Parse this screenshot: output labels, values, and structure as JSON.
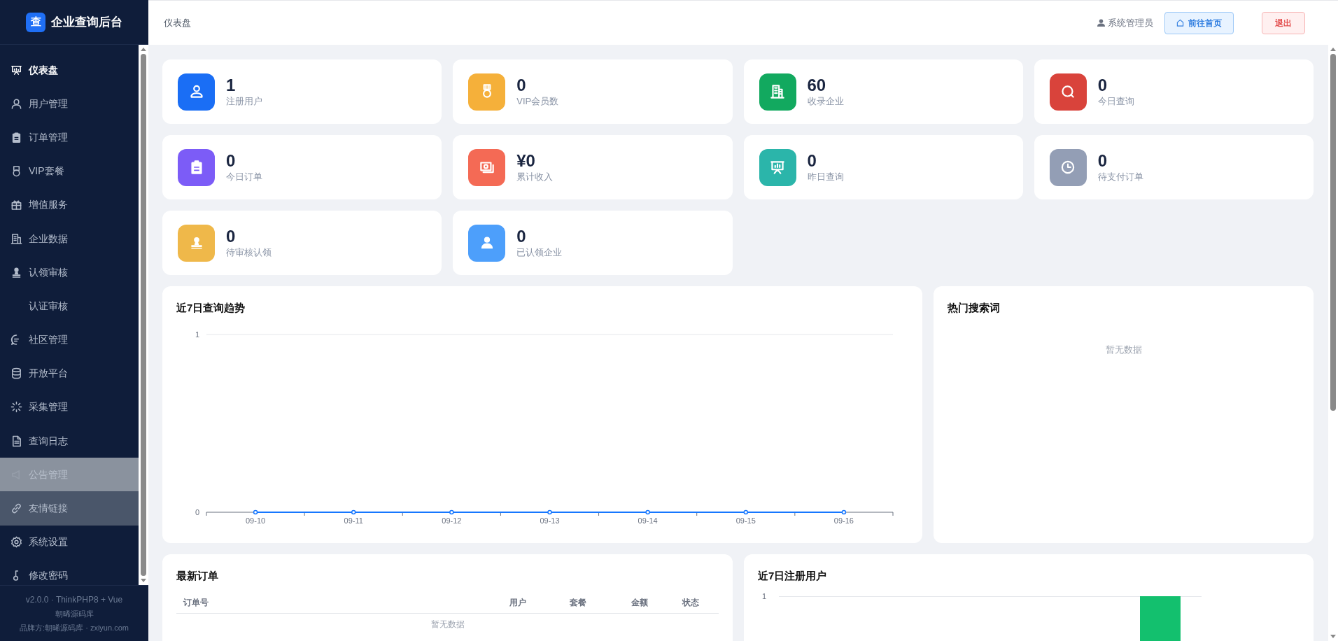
{
  "sidebar": {
    "logo_mark": "查",
    "title": "企业查询后台",
    "items": [
      {
        "label": "仪表盘",
        "selected": true,
        "hovered": false,
        "highlighted": false
      },
      {
        "label": "用户管理",
        "selected": false,
        "hovered": false,
        "highlighted": false
      },
      {
        "label": "订单管理",
        "selected": false,
        "hovered": false,
        "highlighted": false
      },
      {
        "label": "VIP套餐",
        "selected": false,
        "hovered": false,
        "highlighted": false
      },
      {
        "label": "增值服务",
        "selected": false,
        "hovered": false,
        "highlighted": false
      },
      {
        "label": "企业数据",
        "selected": false,
        "hovered": false,
        "highlighted": false
      },
      {
        "label": "认领审核",
        "selected": false,
        "hovered": false,
        "highlighted": false
      },
      {
        "label": "认证审核",
        "selected": false,
        "hovered": false,
        "highlighted": false
      },
      {
        "label": "社区管理",
        "selected": false,
        "hovered": false,
        "highlighted": false
      },
      {
        "label": "开放平台",
        "selected": false,
        "hovered": false,
        "highlighted": false
      },
      {
        "label": "采集管理",
        "selected": false,
        "hovered": false,
        "highlighted": false
      },
      {
        "label": "查询日志",
        "selected": false,
        "hovered": false,
        "highlighted": false
      },
      {
        "label": "公告管理",
        "selected": false,
        "hovered": true,
        "highlighted": false
      },
      {
        "label": "友情链接",
        "selected": false,
        "hovered": false,
        "highlighted": true
      },
      {
        "label": "系统设置",
        "selected": false,
        "hovered": false,
        "highlighted": false
      },
      {
        "label": "修改密码",
        "selected": false,
        "hovered": false,
        "highlighted": false
      }
    ],
    "footer": [
      "v2.0.0 · ThinkPHP8 + Vue",
      "朝晞源码库",
      "品牌方:朝晞源码库 · zxiyun.com"
    ]
  },
  "header": {
    "breadcrumb": "仪表盘",
    "user": "系统管理员",
    "home_button": "前往首页",
    "logout_button": "退出"
  },
  "stats": [
    {
      "value": "1",
      "label": "注册用户",
      "color": "#1a6ef5"
    },
    {
      "value": "0",
      "label": "VIP会员数",
      "color": "#f5b03a"
    },
    {
      "value": "60",
      "label": "收录企业",
      "color": "#12a95f"
    },
    {
      "value": "0",
      "label": "今日查询",
      "color": "#d9433b"
    },
    {
      "value": "0",
      "label": "今日订单",
      "color": "#7c5cf7"
    },
    {
      "value": "¥0",
      "label": "累计收入",
      "color": "#f46a55"
    },
    {
      "value": "0",
      "label": "昨日查询",
      "color": "#2bb5aa"
    },
    {
      "value": "0",
      "label": "待支付订单",
      "color": "#939eb5"
    },
    {
      "value": "0",
      "label": "待审核认领",
      "color": "#efb84a"
    },
    {
      "value": "0",
      "label": "已认领企业",
      "color": "#4d9ffb"
    }
  ],
  "trend": {
    "title": "近7日查询趋势",
    "chart_data": {
      "type": "line",
      "categories": [
        "09-10",
        "09-11",
        "09-12",
        "09-13",
        "09-14",
        "09-15",
        "09-16"
      ],
      "series": [
        {
          "color": "#1677ff",
          "marker": "circle",
          "values": [
            0,
            0,
            0,
            0,
            0,
            0,
            0
          ]
        }
      ],
      "ylim": [
        0,
        1
      ],
      "yticks": [
        0,
        1
      ]
    }
  },
  "hot_words": {
    "title": "热门搜索词",
    "empty": "暂无数据"
  },
  "orders": {
    "title": "最新订单",
    "columns": [
      "订单号",
      "用户",
      "套餐",
      "金额",
      "状态"
    ],
    "empty": "暂无数据"
  },
  "registrations": {
    "title": "近7日注册用户",
    "y_tick": "1"
  }
}
